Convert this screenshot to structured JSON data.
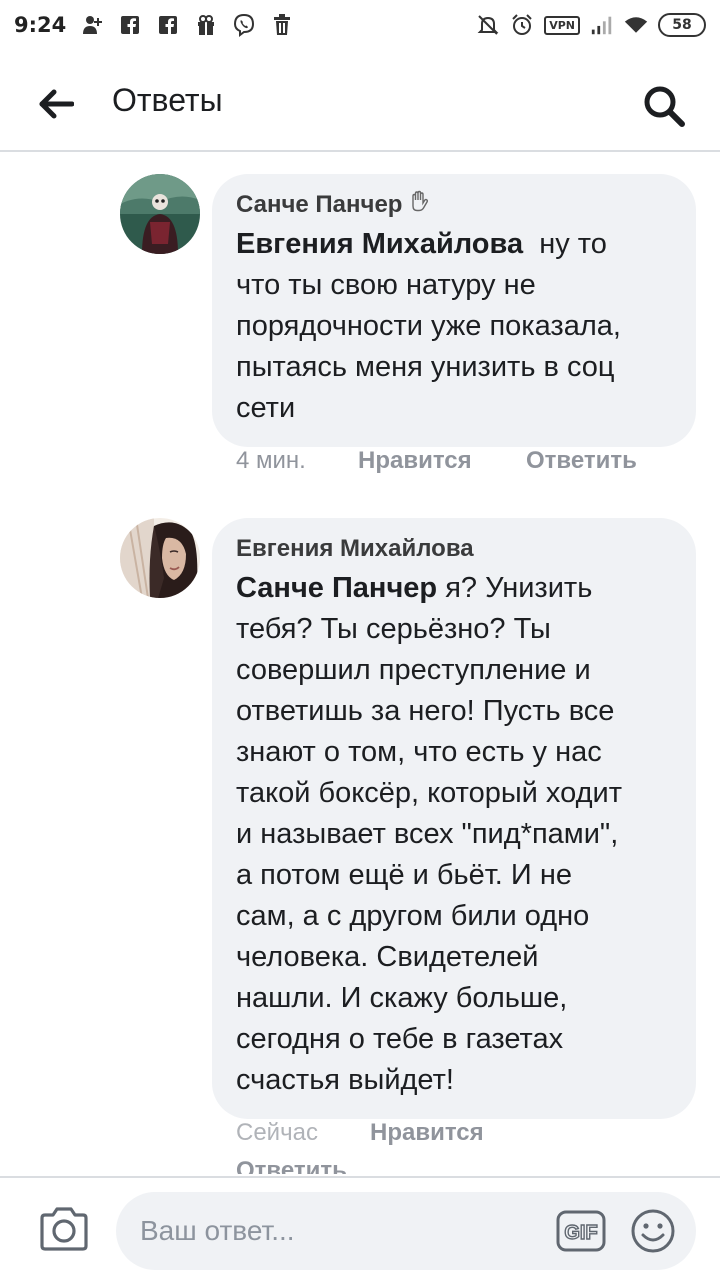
{
  "status_bar": {
    "time": "9:24",
    "vpn_label": "VPN",
    "battery": "58",
    "left_icons": [
      "add-user-notification-icon",
      "facebook-icon",
      "facebook-icon",
      "gift-icon",
      "viber-icon",
      "trash-icon"
    ],
    "right_icons": [
      "muted-icon",
      "alarm-icon",
      "vpn-icon",
      "signal-icon",
      "wifi-icon",
      "battery-icon"
    ]
  },
  "header": {
    "title": "Ответы"
  },
  "comments": [
    {
      "author": "Санче Панчер",
      "author_badge": "waving-hand-emoji",
      "mention": "Евгения Михайлова",
      "text_lines": [
        "ну то",
        "что ты свою натуру не",
        "порядочности уже показала,",
        "пытаясь меня унизить в соц",
        "сети"
      ],
      "time": "4 мин.",
      "like_label": "Нравится",
      "reply_label": "Ответить"
    },
    {
      "author": "Евгения Михайлова",
      "mention": "Санче Панчер",
      "text_lines": [
        "я? Унизить",
        "тебя? Ты серьёзно? Ты",
        "совершил преступление и",
        "ответишь за него! Пусть все",
        "знают о том, что есть у нас",
        "такой боксёр, который ходит",
        "и называет всех \"пид*пами\",",
        "а потом ещё и бьёт. И не",
        "сам, а с другом били одно",
        "человека. Свидетелей",
        "нашли. И скажу больше,",
        "сегодня о тебе в газетах",
        "счастья выйдет!"
      ],
      "time": "Сейчас",
      "like_label": "Нравится",
      "reply_label": "Ответить"
    }
  ],
  "composer": {
    "placeholder": "Ваш ответ...",
    "gif_label": "GIF"
  },
  "colors": {
    "bubble": "#f0f2f5",
    "action_text": "#90949c",
    "divider": "#dadde1",
    "text": "#1c1e21"
  }
}
